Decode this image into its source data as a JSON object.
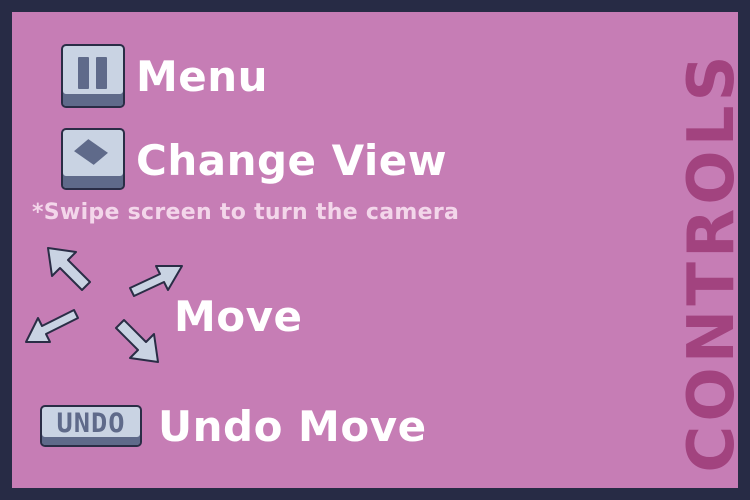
{
  "side_title": "CONTROLS",
  "controls": {
    "menu": {
      "label": "Menu",
      "icon": "pause-icon"
    },
    "change_view": {
      "label": "Change View",
      "icon": "rotate-view-icon"
    },
    "hint": "*Swipe screen to turn the camera",
    "move": {
      "label": "Move",
      "icon": "direction-arrows-icon"
    },
    "undo": {
      "label": "Undo Move",
      "key_text": "UNDO"
    }
  },
  "colors": {
    "frame": "#272b45",
    "panel": "#c67db5",
    "title": "#a2437f",
    "key_face": "#c9d3e3",
    "key_shade": "#5f6a8a",
    "hint_text": "#f3d6ea"
  }
}
